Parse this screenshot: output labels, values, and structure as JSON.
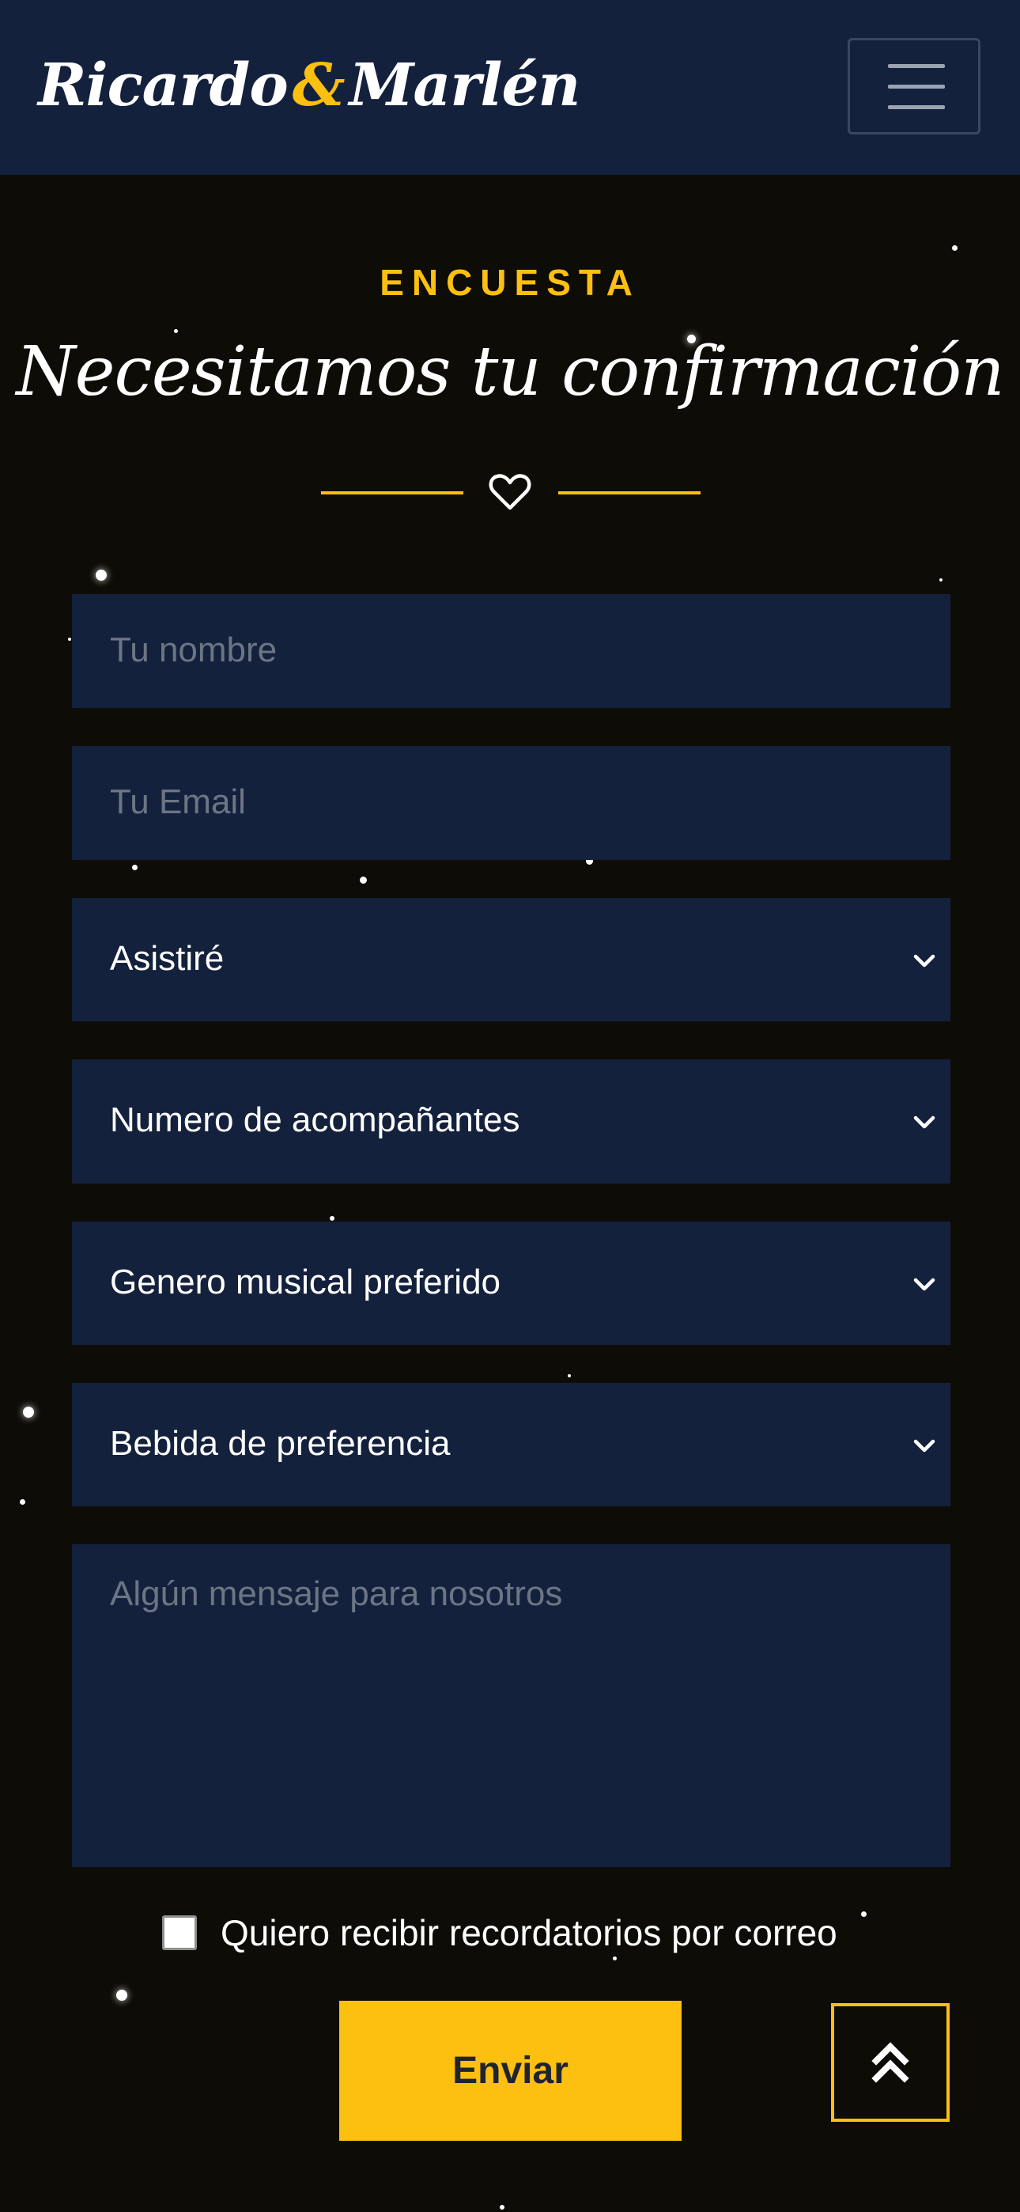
{
  "navbar": {
    "brand_first": "Ricardo",
    "brand_amp": "&",
    "brand_second": "Marlén",
    "menu_icon": "hamburger-icon"
  },
  "section": {
    "label": "ENCUESTA",
    "title": "Necesitamos tu confirmación",
    "divider_icon": "heart-icon"
  },
  "form": {
    "name_placeholder": "Tu nombre",
    "email_placeholder": "Tu Email",
    "attendance_select": "Asistiré",
    "companions_select": "Numero de acompañantes",
    "music_select": "Genero musical preferido",
    "drink_select": "Bebida de preferencia",
    "message_placeholder": "Algún mensaje para nosotros",
    "reminder_label": "Quiero recibir recordatorios por correo",
    "reminder_checked": false,
    "submit_label": "Enviar"
  },
  "back_to_top_icon": "double-chevron-up-icon",
  "colors": {
    "background": "#0d0c06",
    "navbar": "#14213d",
    "field": "#14213d",
    "accent": "#fdc010",
    "text": "#ffffff",
    "placeholder": "#6c7584"
  }
}
